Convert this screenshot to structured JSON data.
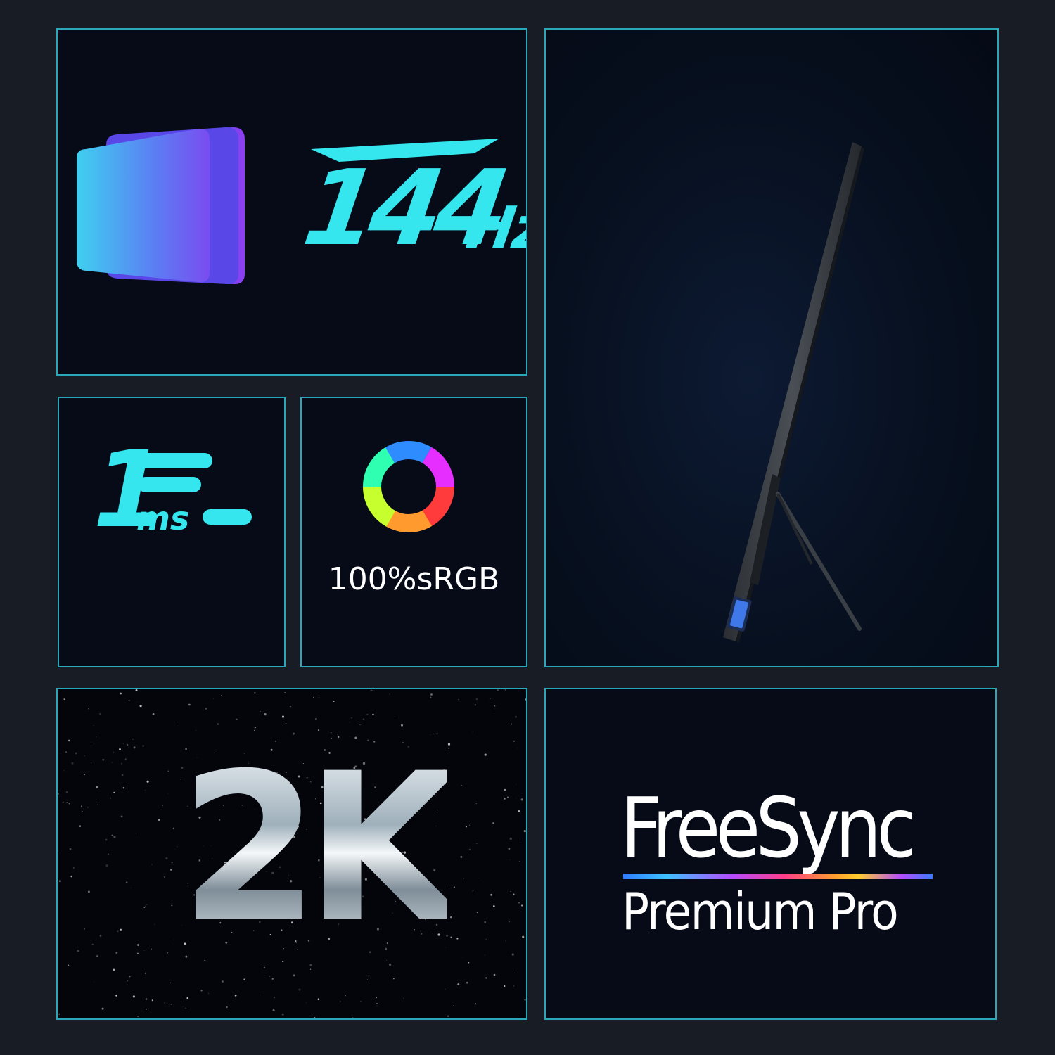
{
  "colors": {
    "accent_cyan": "#35e6ef",
    "border": "#2aa7b8",
    "tile_background": "#070b17"
  },
  "features": {
    "refresh": {
      "value": "144",
      "unit": "Hz",
      "icon": "display-frames-icon"
    },
    "response": {
      "value": "1",
      "unit": "ms",
      "icon": "speed-lines-icon"
    },
    "color": {
      "label": "100%sRGB",
      "icon": "color-wheel-icon"
    },
    "resolution": {
      "label": "2K"
    },
    "sync": {
      "title": "FreeSync",
      "subtitle": "Premium Pro"
    }
  },
  "product": {
    "image": "portable-monitor-side-view"
  }
}
